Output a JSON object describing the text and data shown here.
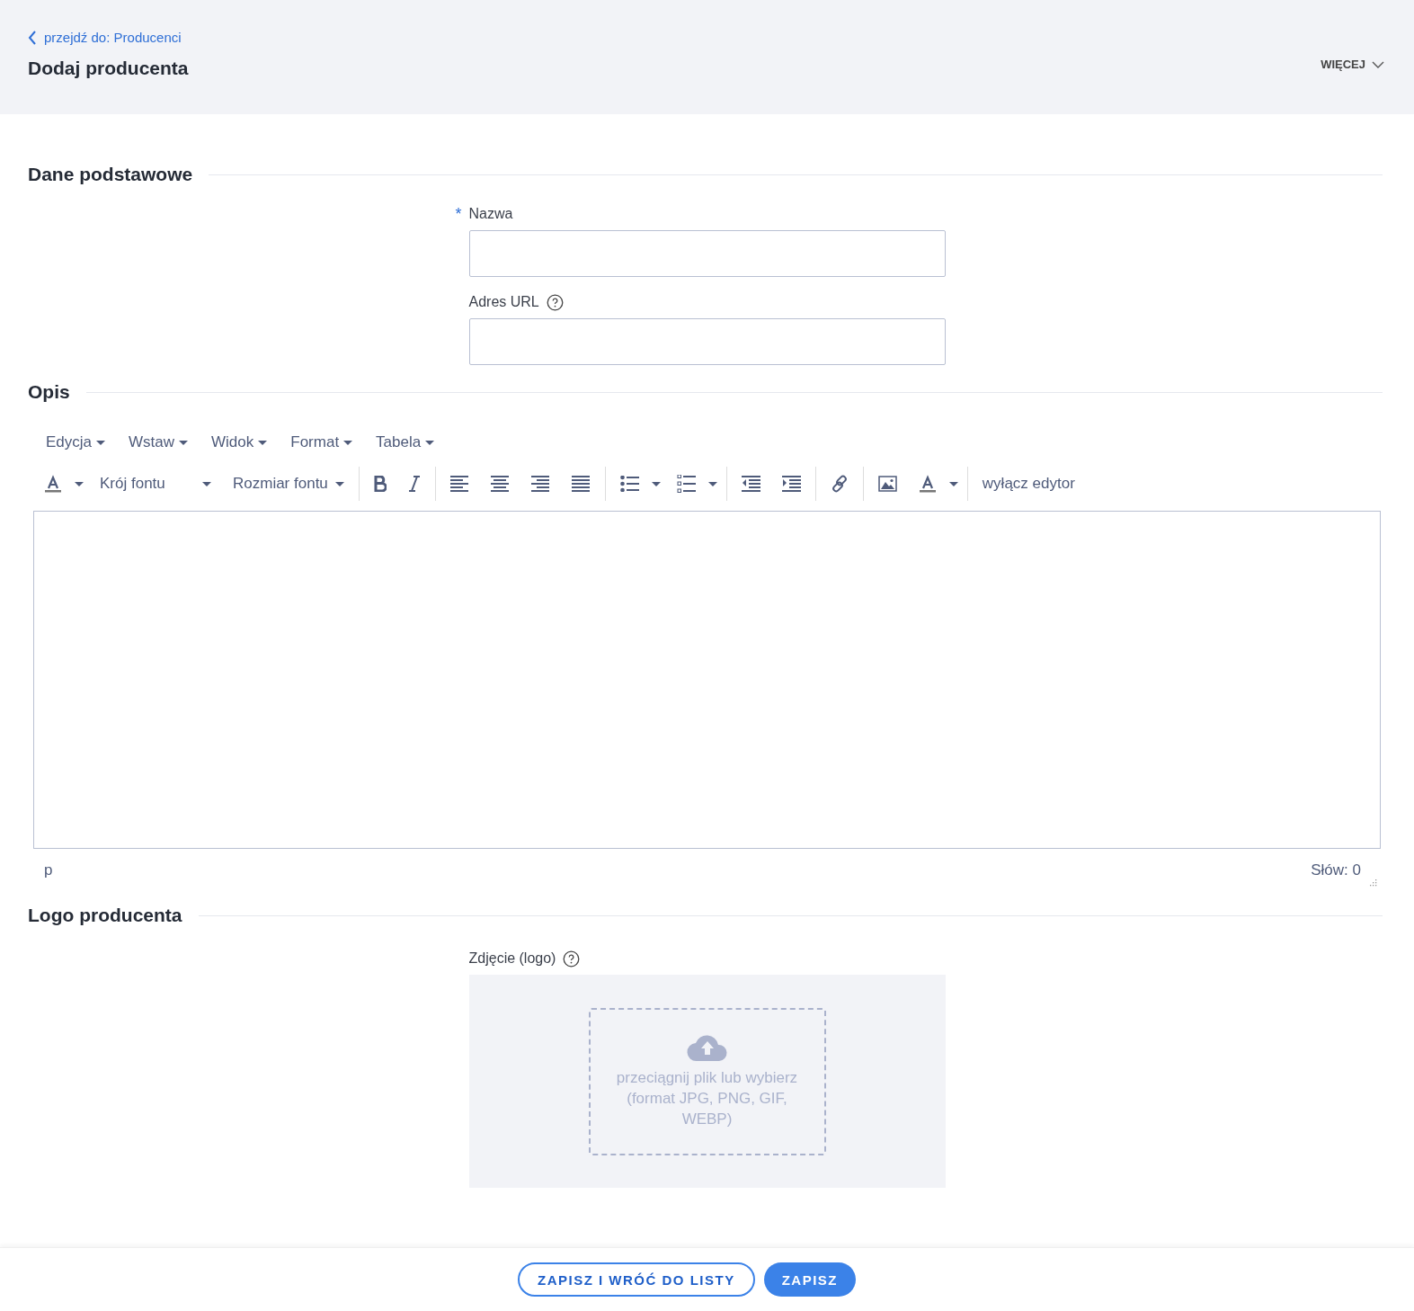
{
  "header": {
    "back_link": "przejdź do: Producenci",
    "title": "Dodaj producenta",
    "more_button": "WIĘCEJ"
  },
  "basic_section": {
    "title": "Dane podstawowe",
    "fields": [
      {
        "label": "Nazwa",
        "required_mark": "*",
        "help": false
      },
      {
        "label": "Adres URL",
        "help": true
      }
    ]
  },
  "description_section": {
    "title": "Opis",
    "menus": [
      "Edycja",
      "Wstaw",
      "Widok",
      "Format",
      "Tabela"
    ],
    "toolbar": [
      [
        {
          "kind": "text-color",
          "dropdown": true
        },
        {
          "kind": "select",
          "label": "Krój fontu",
          "wide": true
        },
        {
          "kind": "select",
          "label": "Rozmiar fontu",
          "wide": false
        }
      ],
      [
        {
          "kind": "bold",
          "dropdown": false
        },
        {
          "kind": "italic",
          "dropdown": false
        }
      ],
      [
        {
          "kind": "align-left",
          "dropdown": false
        },
        {
          "kind": "align-center",
          "dropdown": false
        },
        {
          "kind": "align-right",
          "dropdown": false
        },
        {
          "kind": "justify",
          "dropdown": false
        }
      ],
      [
        {
          "kind": "bullet-list",
          "dropdown": true
        },
        {
          "kind": "numbered-list",
          "dropdown": true
        }
      ],
      [
        {
          "kind": "outdent",
          "dropdown": false
        },
        {
          "kind": "indent",
          "dropdown": false
        }
      ],
      [
        {
          "kind": "link",
          "dropdown": false
        }
      ],
      [
        {
          "kind": "image",
          "dropdown": false
        },
        {
          "kind": "text-color",
          "dropdown": true
        }
      ],
      [
        {
          "kind": "text",
          "label": "wyłącz edytor"
        }
      ]
    ],
    "status_path": "p",
    "word_count": "Słów: 0"
  },
  "logo_section": {
    "title": "Logo producenta",
    "field": {
      "label": "Zdjęcie (logo)",
      "help": true
    },
    "dropzone": "przeciągnij plik lub wybierz (format JPG, PNG, GIF, WEBP)"
  },
  "footer": {
    "buttons": [
      {
        "label": "ZAPISZ I WRÓĆ DO LISTY",
        "kind": "outline"
      },
      {
        "label": "ZAPISZ",
        "kind": "primary"
      }
    ]
  }
}
